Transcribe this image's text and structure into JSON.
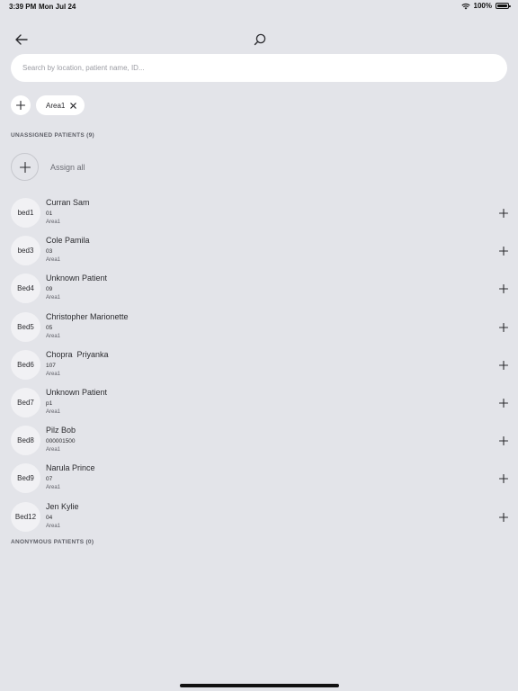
{
  "status_bar": {
    "time": "3:39 PM",
    "date": "Mon Jul 24",
    "battery": "100%"
  },
  "header": {
    "back_icon": "arrow-left-icon",
    "search_icon": "magnifier-icon"
  },
  "search": {
    "placeholder": "Search by location, patient name, ID...",
    "value": ""
  },
  "filters": {
    "add_icon": "plus-icon",
    "chips": [
      {
        "label": "Area1",
        "remove_icon": "close-icon"
      }
    ]
  },
  "unassigned": {
    "header": "UNASSIGNED PATIENTS (9)",
    "assign_all_label": "Assign all",
    "patients": [
      {
        "bed": "bed1",
        "name": "Curran Sam",
        "id": "01",
        "area": "Area1"
      },
      {
        "bed": "bed3",
        "name": "Cole Pamila",
        "id": "03",
        "area": "Area1"
      },
      {
        "bed": "Bed4",
        "name": "Unknown Patient",
        "id": "09",
        "area": "Area1"
      },
      {
        "bed": "Bed5",
        "name": "Christopher Marionette",
        "id": "05",
        "area": "Area1"
      },
      {
        "bed": "Bed6",
        "name": "Chopra  Priyanka",
        "id": "107",
        "area": "Area1"
      },
      {
        "bed": "Bed7",
        "name": "Unknown Patient",
        "id": "p1",
        "area": "Area1"
      },
      {
        "bed": "Bed8",
        "name": "Pilz Bob",
        "id": "000001500",
        "area": "Area1"
      },
      {
        "bed": "Bed9",
        "name": "Narula Prince",
        "id": "07",
        "area": "Area1"
      },
      {
        "bed": "Bed12",
        "name": "Jen Kylie",
        "id": "04",
        "area": "Area1"
      }
    ]
  },
  "anonymous": {
    "header": "ANONYMOUS PATIENTS (0)"
  },
  "colors": {
    "background": "#e3e4e9",
    "surface": "#ffffff",
    "bed_circle": "#f1f1f4",
    "text": "#2b2b2f",
    "muted_text": "#5d5e66"
  }
}
